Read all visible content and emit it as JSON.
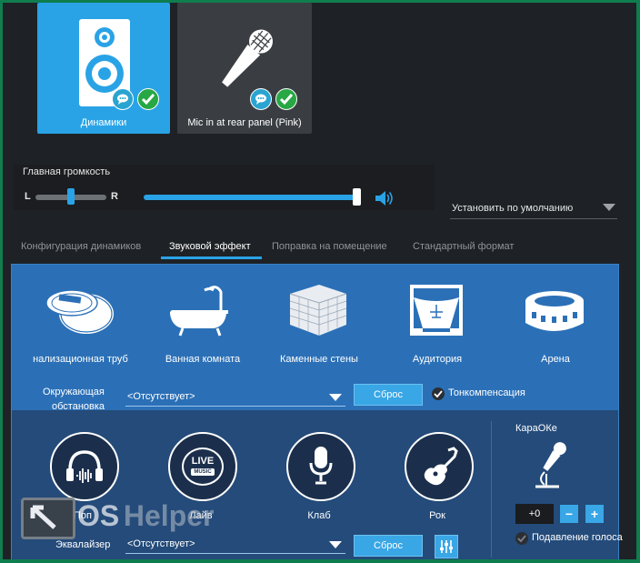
{
  "devices": [
    {
      "label": "Динамики",
      "selected": true
    },
    {
      "label": "Mic in at rear panel (Pink)",
      "selected": false
    }
  ],
  "volume": {
    "title": "Главная громкость",
    "left_label": "L",
    "right_label": "R",
    "level": 0.97,
    "balance": 0.5
  },
  "default_select": {
    "value": "Установить по умолчанию"
  },
  "tabs": [
    {
      "label": "Конфигурация динамиков",
      "active": false
    },
    {
      "label": "Звуковой эффект",
      "active": true
    },
    {
      "label": "Поправка на помещение",
      "active": false
    },
    {
      "label": "Стандартный формат",
      "active": false
    }
  ],
  "environments": [
    {
      "label": "нализационная труб",
      "icon": "pipe-icon"
    },
    {
      "label": "Ванная комната",
      "icon": "bathtub-icon"
    },
    {
      "label": "Каменные стены",
      "icon": "stone-wall-icon"
    },
    {
      "label": "Аудитория",
      "icon": "auditorium-icon"
    },
    {
      "label": "Арена",
      "icon": "arena-icon"
    }
  ],
  "environment_row": {
    "label_line1": "Окружающая",
    "label_line2": "обстановка",
    "select_value": "<Отсутствует>",
    "reset_label": "Сброс",
    "loudness_label": "Тонкомпенсация"
  },
  "presets": [
    {
      "label": "Поп",
      "icon": "headphones-icon"
    },
    {
      "label": "Лайв",
      "icon": "live-music-icon"
    },
    {
      "label": "Клаб",
      "icon": "microphone-icon"
    },
    {
      "label": "Рок",
      "icon": "guitar-icon"
    }
  ],
  "live_badge": {
    "line1": "LIVE",
    "line2": "MUSIC"
  },
  "equalizer_row": {
    "label": "Эквалайзер",
    "select_value": "<Отсутствует>",
    "reset_label": "Сброс"
  },
  "karaoke": {
    "title": "КараОКе",
    "value": "+0",
    "minus": "−",
    "plus": "+",
    "vocal_cancel_label": "Подавление голоса"
  },
  "watermark": {
    "part1": "OS",
    "part2": " Helper"
  },
  "colors": {
    "accent": "#29a3e6",
    "panel": "#2b70b7",
    "background": "#1e2226",
    "border": "#0f7d4e",
    "check_green": "#27a844"
  }
}
